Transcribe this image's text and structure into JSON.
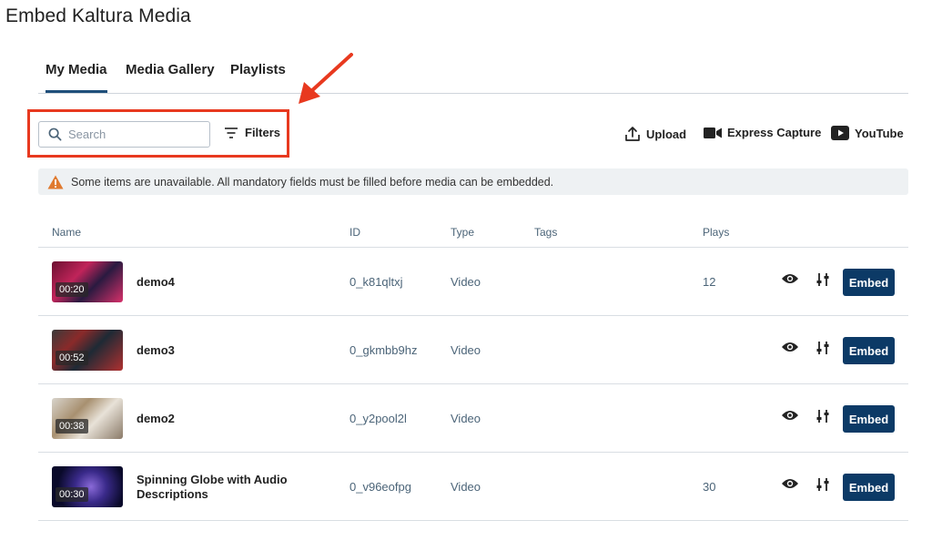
{
  "page": {
    "title": "Embed Kaltura Media"
  },
  "tabs": [
    {
      "label": "My Media",
      "active": true
    },
    {
      "label": "Media Gallery",
      "active": false
    },
    {
      "label": "Playlists",
      "active": false
    }
  ],
  "toolbar": {
    "search_placeholder": "Search",
    "search_icon": "search-icon",
    "filters_label": "Filters",
    "filters_icon": "filter-icon",
    "highlight_color": "#e8391f",
    "actions": [
      {
        "label": "Upload",
        "icon": "upload-icon"
      },
      {
        "label": "Express Capture",
        "icon": "camera-icon"
      },
      {
        "label": "YouTube",
        "icon": "youtube-icon"
      }
    ]
  },
  "banner": {
    "icon": "warning-icon",
    "text": "Some items are unavailable. All mandatory fields must be filled before media can be embedded."
  },
  "table": {
    "columns": [
      "Name",
      "ID",
      "Type",
      "Tags",
      "Plays"
    ],
    "rows": [
      {
        "duration": "00:20",
        "name": "demo4",
        "id": "0_k81qltxj",
        "type": "Video",
        "tags": "",
        "plays": "12",
        "action": "Embed"
      },
      {
        "duration": "00:52",
        "name": "demo3",
        "id": "0_gkmbb9hz",
        "type": "Video",
        "tags": "",
        "plays": "",
        "action": "Embed"
      },
      {
        "duration": "00:38",
        "name": "demo2",
        "id": "0_y2pool2l",
        "type": "Video",
        "tags": "",
        "plays": "",
        "action": "Embed"
      },
      {
        "duration": "00:30",
        "name": "Spinning Globe with Audio Descriptions",
        "id": "0_v96eofpg",
        "type": "Video",
        "tags": "",
        "plays": "30",
        "action": "Embed"
      }
    ]
  },
  "colors": {
    "accent": "#0c3a66",
    "warning": "#e07a2f",
    "annotation": "#e8391f"
  }
}
